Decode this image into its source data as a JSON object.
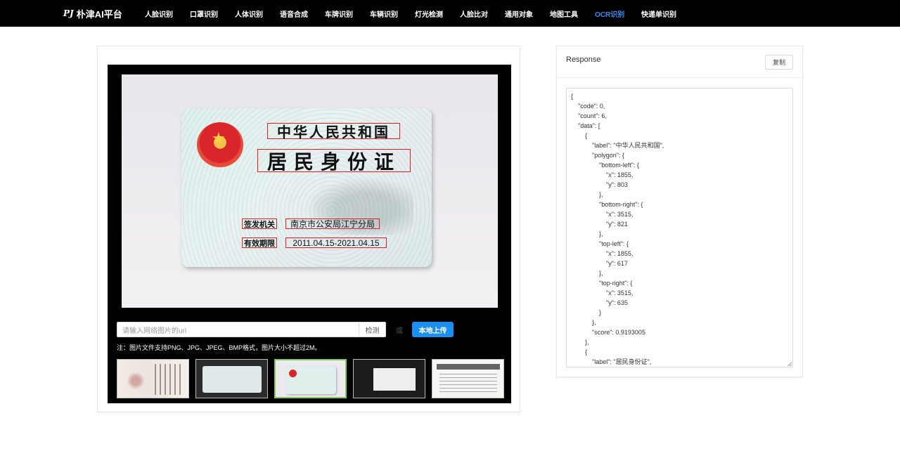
{
  "nav": {
    "brand_logo": "PJ",
    "brand": "朴津AI平台",
    "items": [
      {
        "label": "人脸识别"
      },
      {
        "label": "口罩识别"
      },
      {
        "label": "人体识别"
      },
      {
        "label": "语音合成"
      },
      {
        "label": "车牌识别"
      },
      {
        "label": "车辆识别"
      },
      {
        "label": "灯光检测"
      },
      {
        "label": "人脸比对"
      },
      {
        "label": "通用对象"
      },
      {
        "label": "地图工具"
      },
      {
        "label": "OCR识别",
        "active": true
      },
      {
        "label": "快递单识别"
      }
    ],
    "active_color": "#3c8ff2"
  },
  "viewer": {
    "ocr_texts": {
      "country": "中华人民共和国",
      "card_type": "居民身份证",
      "issuer_label": "签发机关",
      "issuer_value": "南京市公安局江宁分局",
      "validity_label": "有效期限",
      "validity_value": "2011.04.15-2021.04.15"
    },
    "box_color": "#e02020",
    "url_placeholder": "请输入网络图片的url",
    "detect_label": "检测",
    "or_label": "或",
    "upload_label": "本地上传",
    "upload_color": "#1d8ef2",
    "note": "注：图片文件支持PNG、JPG、JPEG、BMP格式，图片大小不超过2M。",
    "thumb_selected_index": 2
  },
  "response": {
    "title": "Response",
    "copy_label": "复制",
    "json_lines": [
      "{",
      "    \"code\": 0,",
      "    \"count\": 6,",
      "    \"data\": [",
      "        {",
      "            \"label\": \"中华人民共和国\",",
      "            \"polygon\": {",
      "                \"bottom-left\": {",
      "                    \"x\": 1855,",
      "                    \"y\": 803",
      "                },",
      "                \"bottom-right\": {",
      "                    \"x\": 3515,",
      "                    \"y\": 821",
      "                },",
      "                \"top-left\": {",
      "                    \"x\": 1855,",
      "                    \"y\": 617",
      "                },",
      "                \"top-right\": {",
      "                    \"x\": 3515,",
      "                    \"y\": 635",
      "                }",
      "            },",
      "            \"score\": 0.9193005",
      "        },",
      "        {",
      "            \"label\": \"居民身份证\","
    ]
  }
}
